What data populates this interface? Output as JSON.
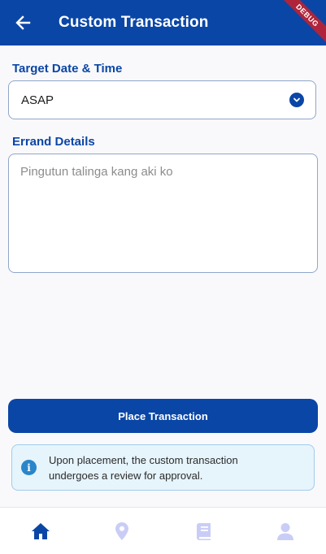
{
  "appbar": {
    "title": "Custom Transaction",
    "debug_label": "DEBUG"
  },
  "form": {
    "target_label": "Target Date & Time",
    "target_value": "ASAP",
    "errand_label": "Errand Details",
    "errand_placeholder": "Pingutun talinga kang aki ko"
  },
  "actions": {
    "place_label": "Place Transaction"
  },
  "info": {
    "message": "Upon placement, the custom transaction undergoes a review for approval."
  },
  "nav": {
    "items": [
      {
        "icon": "home-icon",
        "active": true
      },
      {
        "icon": "location-icon",
        "active": false
      },
      {
        "icon": "book-icon",
        "active": false
      },
      {
        "icon": "person-icon",
        "active": false
      }
    ]
  },
  "colors": {
    "primary": "#0a46a6",
    "nav_inactive": "#c9cdf6",
    "info_bg": "#e6f4fc",
    "info_icon": "#2a85c9"
  }
}
